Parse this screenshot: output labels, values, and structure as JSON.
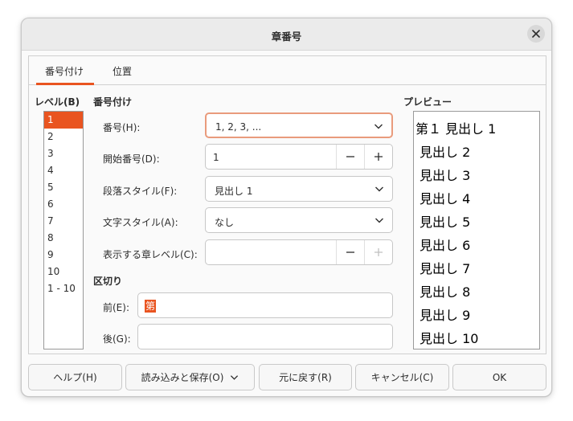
{
  "title": "章番号",
  "tabs": [
    {
      "label": "番号付け",
      "active": true
    },
    {
      "label": "位置",
      "active": false
    }
  ],
  "level_section": {
    "label": "レベル(B)",
    "items": [
      "1",
      "2",
      "3",
      "4",
      "5",
      "6",
      "7",
      "8",
      "9",
      "10",
      "1 - 10"
    ],
    "selected": "1"
  },
  "numbering": {
    "section_label": "番号付け",
    "number_label": "番号(H):",
    "number_value": "1, 2, 3, ...",
    "start_label": "開始番号(D):",
    "start_value": "1",
    "para_style_label": "段落スタイル(F):",
    "para_style_value": "見出し 1",
    "char_style_label": "文字スタイル(A):",
    "char_style_value": "なし",
    "show_levels_label": "表示する章レベル(C):",
    "show_levels_value": ""
  },
  "separator": {
    "section_label": "区切り",
    "before_label": "前(E):",
    "before_value": "第",
    "after_label": "後(G):",
    "after_value": ""
  },
  "preview": {
    "label": "プレビュー",
    "lines": [
      "第１ 見出し 1",
      "見出し 2",
      "見出し 3",
      "見出し 4",
      "見出し 5",
      "見出し 6",
      "見出し 7",
      "見出し 8",
      "見出し 9",
      "見出し 10"
    ]
  },
  "footer": {
    "help": "ヘルプ(H)",
    "load_save": "読み込みと保存(O)",
    "reset": "元に戻す(R)",
    "cancel": "キャンセル(C)",
    "ok": "OK"
  },
  "colors": {
    "accent": "#e95420",
    "focus_border": "#e99b7c"
  },
  "icons": [
    "close-icon",
    "chevron-down-icon",
    "minus-icon",
    "plus-icon"
  ]
}
